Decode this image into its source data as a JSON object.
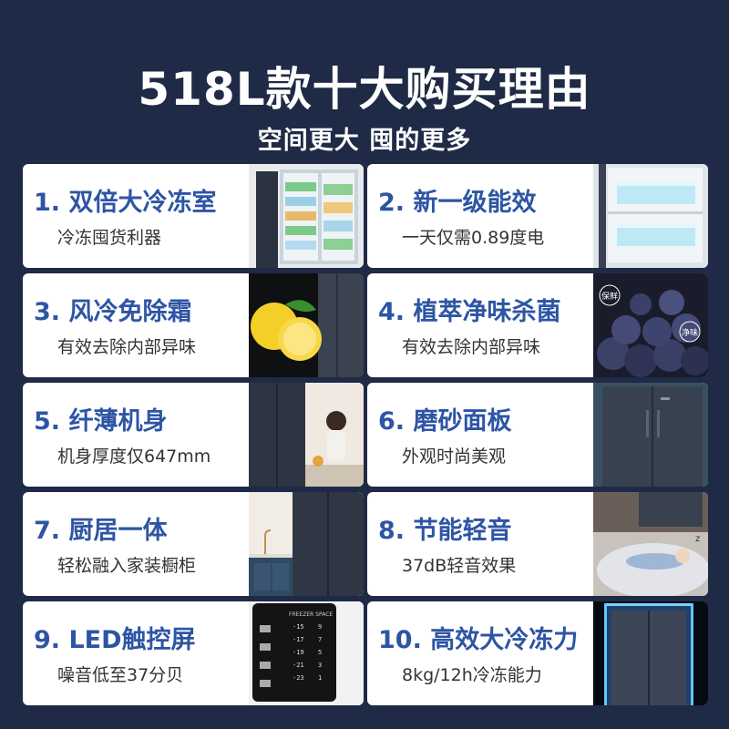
{
  "header": {
    "title": "518L款十大购买理由",
    "subtitle": "空间更大 囤的更多"
  },
  "reasons": [
    {
      "title": "1. 双倍大冷冻室",
      "desc": "冷冻囤货利器",
      "image": "open-fridge-storage-image"
    },
    {
      "title": "2. 新一级能效",
      "desc": "一天仅需0.89度电",
      "image": "fridge-cooling-interior-image"
    },
    {
      "title": "3. 风冷免除霜",
      "desc": "有效去除内部异味",
      "image": "lemon-fridge-image"
    },
    {
      "title": "4. 植萃净味杀菌",
      "desc": "有效去除内部异味",
      "image": "blueberries-image"
    },
    {
      "title": "5. 纤薄机身",
      "desc": "机身厚度仅647mm",
      "image": "woman-kitchen-fridge-image"
    },
    {
      "title": "6. 磨砂面板",
      "desc": "外观时尚美观",
      "image": "frosted-panel-fridge-image"
    },
    {
      "title": "7. 厨居一体",
      "desc": "轻松融入家装橱柜",
      "image": "kitchen-cabinet-fridge-image"
    },
    {
      "title": "8. 节能轻音",
      "desc": "37dB轻音效果",
      "image": "sleeping-baby-image"
    },
    {
      "title": "9. LED触控屏",
      "desc": "噪音低至37分贝",
      "image": "led-touch-panel-image"
    },
    {
      "title": "10. 高效大冷冻力",
      "desc": "8kg/12h冷冻能力",
      "image": "glowing-fridge-image"
    }
  ],
  "panel": {
    "header": "FREEZER SPACE",
    "temps": [
      "-15",
      "-17",
      "-19",
      "-21",
      "-23"
    ],
    "nums": [
      "9",
      "7",
      "5",
      "3",
      "1"
    ]
  },
  "badges": {
    "fresh": "保鲜",
    "clean": "净味"
  },
  "colors": {
    "background": "#1f2a46",
    "title_accent": "#2d55a4",
    "card": "#ffffff"
  }
}
